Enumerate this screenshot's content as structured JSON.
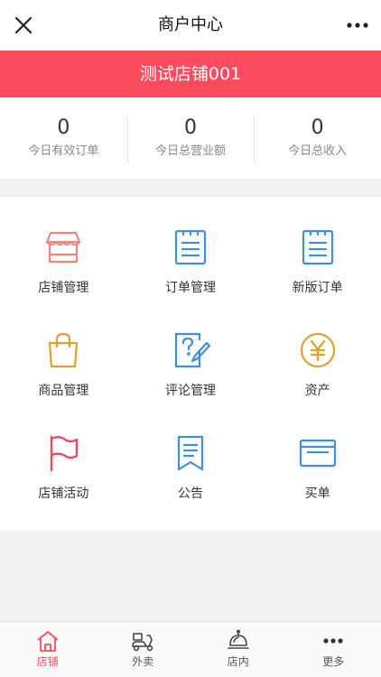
{
  "nav": {
    "title": "商户中心"
  },
  "banner": {
    "store_name": "测试店铺001"
  },
  "stats": [
    {
      "value": "0",
      "label": "今日有效订单"
    },
    {
      "value": "0",
      "label": "今日总营业额"
    },
    {
      "value": "0",
      "label": "今日总收入"
    }
  ],
  "menu": [
    {
      "label": "店铺管理",
      "icon": "store-icon",
      "color": "#f0857f"
    },
    {
      "label": "订单管理",
      "icon": "order-list-icon",
      "color": "#3f8fd9"
    },
    {
      "label": "新版订单",
      "icon": "new-order-icon",
      "color": "#3f8fd9"
    },
    {
      "label": "商品管理",
      "icon": "shopping-bag-icon",
      "color": "#e0a030"
    },
    {
      "label": "评论管理",
      "icon": "review-icon",
      "color": "#3f8fd9"
    },
    {
      "label": "资产",
      "icon": "yen-coin-icon",
      "color": "#e0a030"
    },
    {
      "label": "店铺活动",
      "icon": "flag-icon",
      "color": "#e84a5a"
    },
    {
      "label": "公告",
      "icon": "bookmark-icon",
      "color": "#3f8fd9"
    },
    {
      "label": "买单",
      "icon": "card-icon",
      "color": "#3f8fd9"
    }
  ],
  "tabs": [
    {
      "label": "店铺",
      "icon": "home-icon",
      "active": true
    },
    {
      "label": "外卖",
      "icon": "scooter-icon",
      "active": false
    },
    {
      "label": "店内",
      "icon": "dining-bell-icon",
      "active": false
    },
    {
      "label": "更多",
      "icon": "more-dots-icon",
      "active": false
    }
  ]
}
